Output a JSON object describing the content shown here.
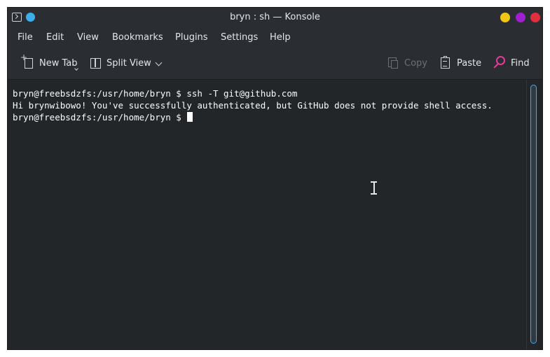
{
  "window": {
    "title": "bryn : sh — Konsole"
  },
  "menubar": {
    "items": [
      "File",
      "Edit",
      "View",
      "Bookmarks",
      "Plugins",
      "Settings",
      "Help"
    ]
  },
  "toolbar": {
    "new_tab": "New Tab",
    "split_view": "Split View",
    "copy": "Copy",
    "paste": "Paste",
    "find": "Find"
  },
  "terminal": {
    "lines": [
      "bryn@freebsdzfs:/usr/home/bryn $ ssh -T git@github.com",
      "Hi brynwibowo! You've successfully authenticated, but GitHub does not provide shell access.",
      "bryn@freebsdzfs:/usr/home/bryn $ "
    ]
  },
  "colors": {
    "background": "#232629",
    "accent": "#3daee9",
    "find_icon": "#e93a9a",
    "minimize": "#f0c514",
    "maximize": "#a020d0",
    "close": "#e03040"
  },
  "icons": {
    "app": "terminal-icon",
    "new_tab": "new-tab-icon",
    "split_view": "split-view-icon",
    "copy": "copy-icon",
    "paste": "paste-icon",
    "find": "search-icon"
  }
}
